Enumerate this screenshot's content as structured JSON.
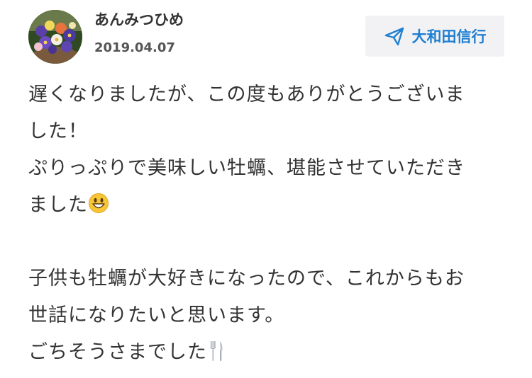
{
  "review": {
    "user_name": "あんみつひめ",
    "date": "2019.04.07",
    "recipient_label": "大和田信行",
    "accent_color": "#1f7fd1",
    "message_lines": [
      "遅くなりましたが、この度もありがとうございま",
      "した！",
      "ぷりっぷりで美味しい牡蠣、堪能させていただき",
      "ました",
      "",
      "子供も牡蠣が大好きになったので、これからもお",
      "世話になりたいと思います。",
      "ごちそうさまでした"
    ],
    "icons": {
      "avatar": "flower-pot-avatar",
      "recipient": "paper-plane-icon",
      "emoji_1": "smiling-face-emoji",
      "emoji_2": "fork-and-knife-emoji"
    }
  }
}
